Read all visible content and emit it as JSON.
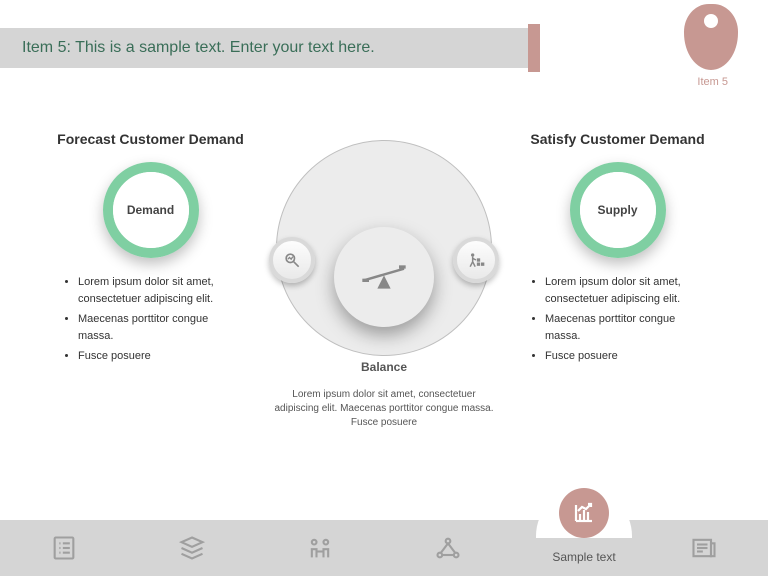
{
  "header": {
    "title": "Item 5: This is a sample text. Enter your text here."
  },
  "badge": {
    "label": "Item 5"
  },
  "left": {
    "heading": "Forecast Customer Demand",
    "ring_label": "Demand",
    "bullets": [
      "Lorem ipsum dolor sit amet, consectetuer adipiscing elit.",
      "Maecenas porttitor congue massa.",
      "Fusce posuere"
    ]
  },
  "right": {
    "heading": "Satisfy Customer Demand",
    "ring_label": "Supply",
    "bullets": [
      "Lorem ipsum dolor sit amet, consectetuer adipiscing elit.",
      "Maecenas porttitor congue massa.",
      "Fusce posuere"
    ]
  },
  "center": {
    "label": "Balance",
    "desc": "Lorem ipsum dolor sit amet, consectetuer adipiscing elit. Maecenas porttitor congue massa. Fusce posuere"
  },
  "bottom": {
    "bump_label": "Sample text"
  }
}
